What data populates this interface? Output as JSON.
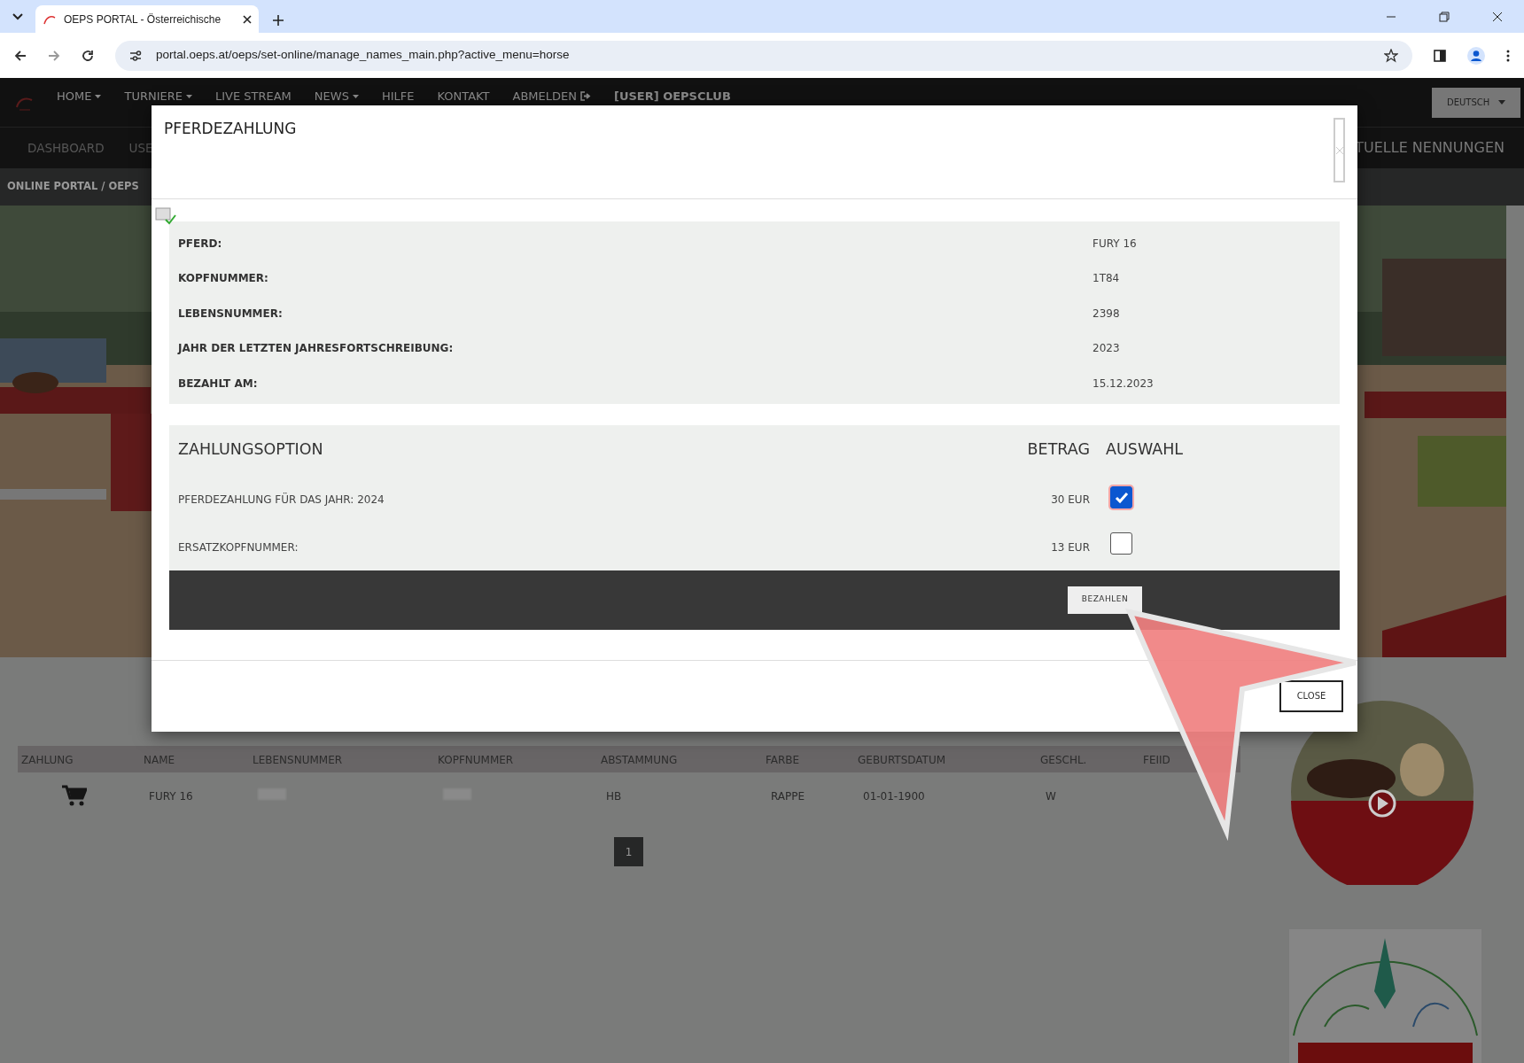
{
  "browser": {
    "tab_title": "OEPS PORTAL - Österreichische",
    "url": "portal.oeps.at/oeps/set-online/manage_names_main.php?active_menu=horse"
  },
  "site_nav": {
    "items": [
      {
        "label": "HOME",
        "dropdown": true
      },
      {
        "label": "TURNIERE",
        "dropdown": true
      },
      {
        "label": "LIVE STREAM",
        "dropdown": false
      },
      {
        "label": "NEWS",
        "dropdown": true
      },
      {
        "label": "HILFE",
        "dropdown": false
      },
      {
        "label": "KONTAKT",
        "dropdown": false
      },
      {
        "label": "ABMELDEN",
        "dropdown": false,
        "kind": "logout"
      },
      {
        "label": "[USER] OEPSCLUB",
        "dropdown": false,
        "kind": "user"
      }
    ],
    "language": "DEUTSCH"
  },
  "sub_nav": {
    "items": [
      "DASHBOARD",
      "USE"
    ],
    "right_item": "TUELLE NENNUNGEN"
  },
  "breadcrumb": {
    "separator": "/",
    "items": [
      "ONLINE PORTAL",
      "OEPS"
    ]
  },
  "horses_table": {
    "columns": [
      "ZAHLUNG",
      "NAME",
      "LEBENSNUMMER",
      "KOPFNUMMER",
      "ABSTAMMUNG",
      "FARBE",
      "GEBURTSDATUM",
      "GESCHL.",
      "FEIID"
    ],
    "rows": [
      {
        "cells": [
          {
            "kind": "cart"
          },
          {
            "kind": "text",
            "text": "FURY 16"
          },
          {
            "kind": "redacted"
          },
          {
            "kind": "redacted"
          },
          {
            "kind": "text",
            "text": "HB"
          },
          {
            "kind": "text",
            "text": "RAPPE"
          },
          {
            "kind": "text",
            "text": "01-01-1900"
          },
          {
            "kind": "text",
            "text": "W"
          }
        ]
      }
    ]
  },
  "pagination": [
    {
      "label": "1",
      "selected": true
    }
  ],
  "modal": {
    "title": "PFERDEZAHLUNG",
    "details": [
      {
        "label": "PFERD:",
        "value": "FURY 16"
      },
      {
        "label": "KOPFNUMMER:",
        "value": "1T84"
      },
      {
        "label": "LEBENSNUMMER:",
        "value": "2398"
      },
      {
        "label": "JAHR DER LETZTEN JAHRESFORTSCHREIBUNG:",
        "value": "2023"
      },
      {
        "label": "BEZAHLT AM:",
        "value": "15.12.2023"
      }
    ],
    "options_header": {
      "option": "ZAHLUNGSOPTION",
      "amount": "BETRAG",
      "choice": "AUSWAHL"
    },
    "options": [
      {
        "label": "PFERDEZAHLUNG FÜR DAS JAHR: 2024",
        "amount": "30 EUR",
        "checked": true
      },
      {
        "label": "ERSATZKOPFNUMMER:",
        "amount": "13 EUR",
        "checked": false
      }
    ],
    "pay_button": "BEZAHLEN",
    "close_button": "CLOSE"
  }
}
